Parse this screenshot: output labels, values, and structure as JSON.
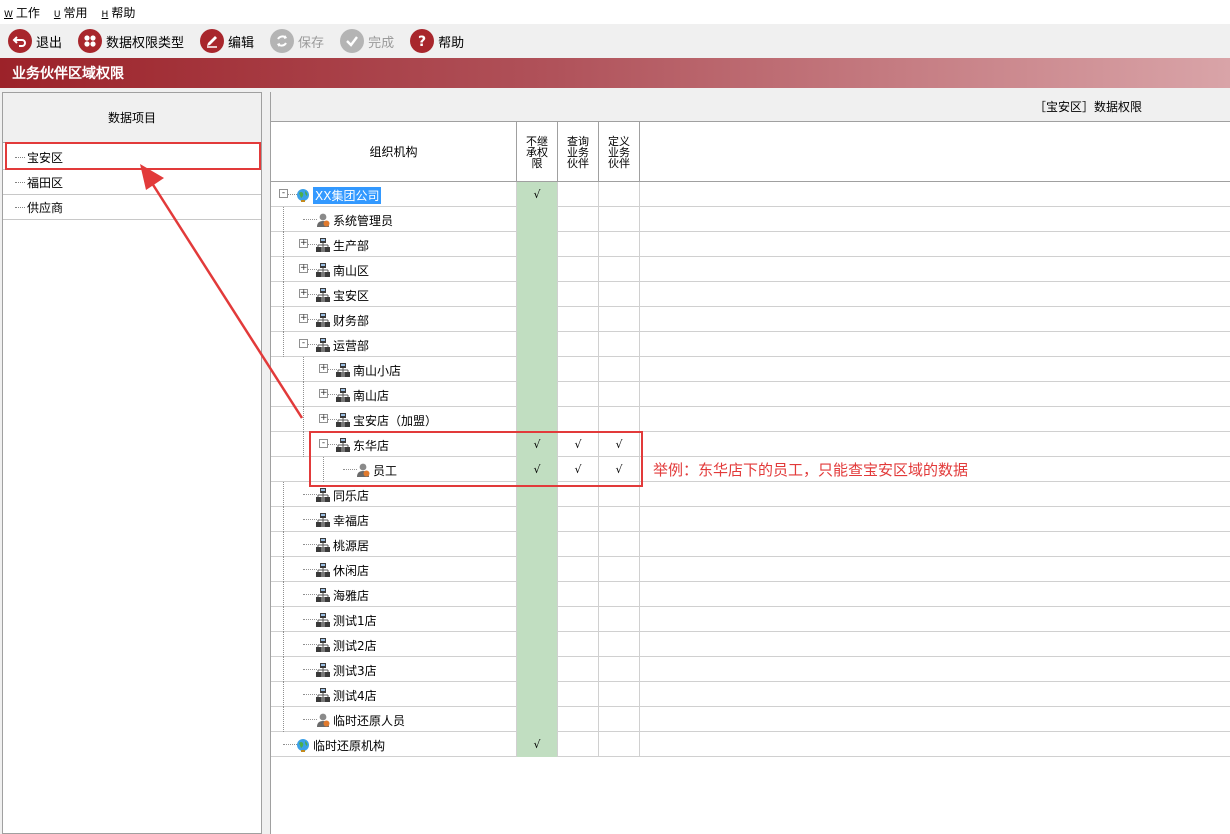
{
  "menu": [
    {
      "accel": "W",
      "label": "工作"
    },
    {
      "accel": "U",
      "label": "常用"
    },
    {
      "accel": "H",
      "label": "帮助"
    }
  ],
  "toolbar": {
    "exit": "退出",
    "perm_type": "数据权限类型",
    "edit": "编辑",
    "save": "保存",
    "finish": "完成",
    "help": "帮助"
  },
  "window_title": "业务伙伴区域权限",
  "left": {
    "header": "数据项目",
    "items": [
      "宝安区",
      "福田区",
      "供应商"
    ]
  },
  "right": {
    "title": "［宝安区］数据权限",
    "columns": {
      "org": "组织机构",
      "c1": "不继承权限",
      "c2": "查询业务伙伴",
      "c3": "定义业务伙伴"
    },
    "check": "√",
    "rows": [
      {
        "label": "XX集团公司",
        "icon": "globe-icon",
        "c1": "√",
        "c2": "",
        "c3": ""
      },
      {
        "label": "系统管理员",
        "icon": "user-icon",
        "c1": "",
        "c2": "",
        "c3": ""
      },
      {
        "label": "生产部",
        "icon": "org-icon",
        "c1": "",
        "c2": "",
        "c3": ""
      },
      {
        "label": "南山区",
        "icon": "org-icon",
        "c1": "",
        "c2": "",
        "c3": ""
      },
      {
        "label": "宝安区",
        "icon": "org-icon",
        "c1": "",
        "c2": "",
        "c3": ""
      },
      {
        "label": "财务部",
        "icon": "org-icon",
        "c1": "",
        "c2": "",
        "c3": ""
      },
      {
        "label": "运营部",
        "icon": "org-icon",
        "c1": "",
        "c2": "",
        "c3": ""
      },
      {
        "label": "南山小店",
        "icon": "org-icon",
        "c1": "",
        "c2": "",
        "c3": ""
      },
      {
        "label": "南山店",
        "icon": "org-icon",
        "c1": "",
        "c2": "",
        "c3": ""
      },
      {
        "label": "宝安店（加盟）",
        "icon": "org-icon",
        "c1": "",
        "c2": "",
        "c3": ""
      },
      {
        "label": "东华店",
        "icon": "org-icon",
        "c1": "√",
        "c2": "√",
        "c3": "√"
      },
      {
        "label": "员工",
        "icon": "user-icon",
        "c1": "√",
        "c2": "√",
        "c3": "√"
      },
      {
        "label": "同乐店",
        "icon": "org-icon",
        "c1": "",
        "c2": "",
        "c3": ""
      },
      {
        "label": "幸福店",
        "icon": "org-icon",
        "c1": "",
        "c2": "",
        "c3": ""
      },
      {
        "label": "桃源居",
        "icon": "org-icon",
        "c1": "",
        "c2": "",
        "c3": ""
      },
      {
        "label": "休闲店",
        "icon": "org-icon",
        "c1": "",
        "c2": "",
        "c3": ""
      },
      {
        "label": "海雅店",
        "icon": "org-icon",
        "c1": "",
        "c2": "",
        "c3": ""
      },
      {
        "label": "测试1店",
        "icon": "org-icon",
        "c1": "",
        "c2": "",
        "c3": ""
      },
      {
        "label": "测试2店",
        "icon": "org-icon",
        "c1": "",
        "c2": "",
        "c3": ""
      },
      {
        "label": "测试3店",
        "icon": "org-icon",
        "c1": "",
        "c2": "",
        "c3": ""
      },
      {
        "label": "测试4店",
        "icon": "org-icon",
        "c1": "",
        "c2": "",
        "c3": ""
      },
      {
        "label": "临时还原人员",
        "icon": "user-icon",
        "c1": "",
        "c2": "",
        "c3": ""
      },
      {
        "label": "临时还原机构",
        "icon": "globe-icon",
        "c1": "√",
        "c2": "",
        "c3": ""
      }
    ]
  },
  "annotation": "举例：东华店下的员工，只能查宝安区域的数据",
  "colors": {
    "accent": "#a8262c",
    "highlight_red": "#e23a3a",
    "green_cell": "#c1dec1",
    "selection": "#3399ff"
  }
}
